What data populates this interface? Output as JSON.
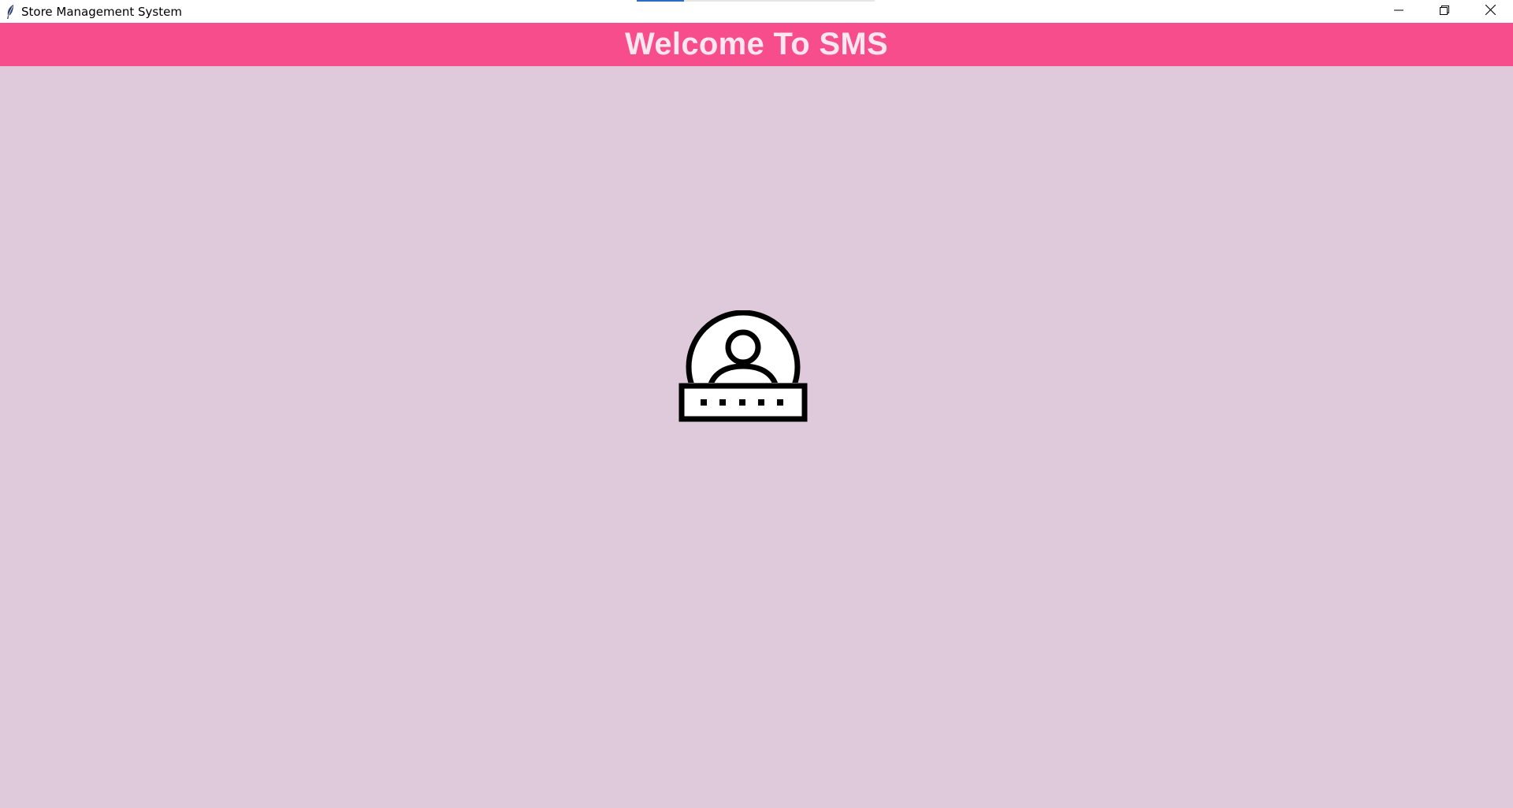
{
  "window": {
    "title": "Store Management System",
    "progress": 0.2,
    "controls": {
      "minimize_icon": "minimize-icon",
      "restore_icon": "restore-icon",
      "close_icon": "close-icon"
    }
  },
  "header": {
    "title": "Welcome To SMS",
    "background": "#f74d8c",
    "text_color": "#ffe6ef"
  },
  "main": {
    "background": "#dfcadc",
    "center_icon": "user-login-icon"
  }
}
